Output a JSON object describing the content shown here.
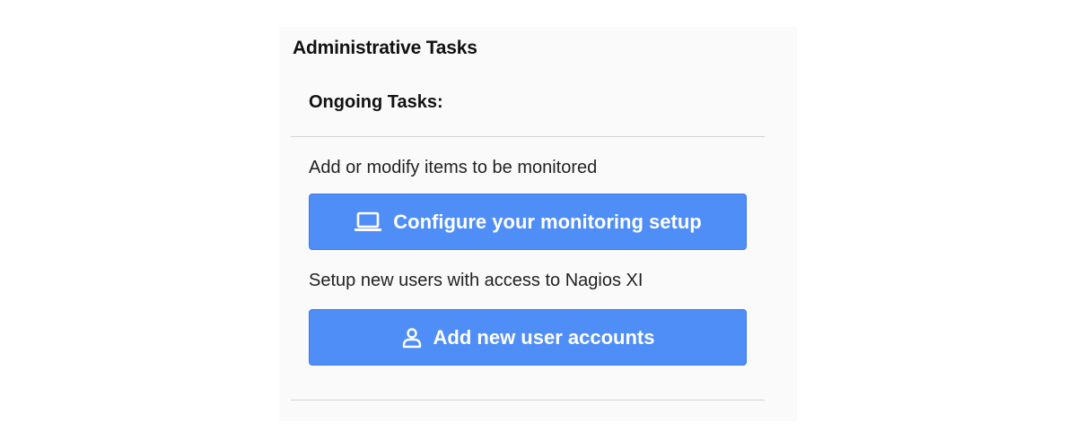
{
  "panel": {
    "title": "Administrative Tasks",
    "section_title": "Ongoing Tasks:"
  },
  "tasks": [
    {
      "description": "Add or modify items to be monitored",
      "button_label": "Configure your monitoring setup",
      "icon": "laptop-icon"
    },
    {
      "description": "Setup new users with access to Nagios XI",
      "button_label": "Add new user accounts",
      "icon": "user-icon"
    }
  ],
  "colors": {
    "button_background": "#4f8ef7",
    "button_text": "#ffffff",
    "panel_background": "#fafafa",
    "divider": "#d4d4d4"
  }
}
